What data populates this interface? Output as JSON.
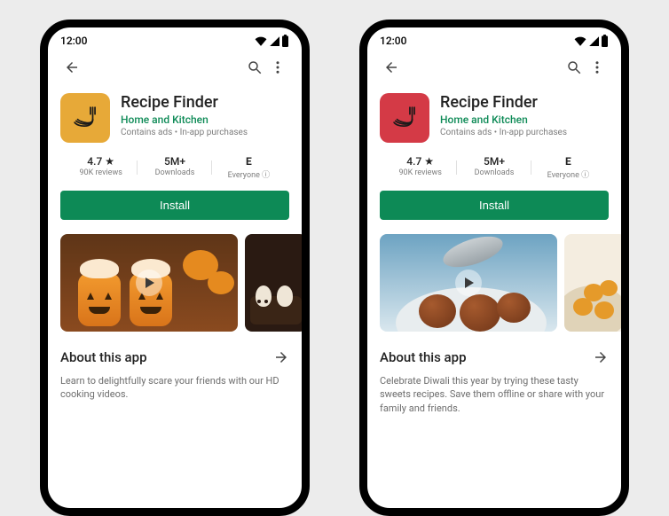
{
  "phones": [
    {
      "status_time": "12:00",
      "app_title": "Recipe Finder",
      "developer": "Home and Kitchen",
      "meta_line": "Contains ads  •  In-app purchases",
      "icon_bg": "#e7a938",
      "rating_line": "4.7 ★",
      "reviews_line": "90K reviews",
      "downloads_value": "5M+",
      "downloads_label": "Downloads",
      "age_value": "E",
      "age_label": "Everyone ⓘ",
      "install_label": "Install",
      "about_heading": "About this app",
      "about_body": "Learn to delightfully scare your friends with our HD cooking videos."
    },
    {
      "status_time": "12:00",
      "app_title": "Recipe Finder",
      "developer": "Home and Kitchen",
      "meta_line": "Contains ads  •  In-app purchases",
      "icon_bg": "#d43a46",
      "rating_line": "4.7 ★",
      "reviews_line": "90K reviews",
      "downloads_value": "5M+",
      "downloads_label": "Downloads",
      "age_value": "E",
      "age_label": "Everyone ⓘ",
      "install_label": "Install",
      "about_heading": "About this app",
      "about_body": "Celebrate Diwali this year by trying these tasty sweets recipes. Save them offline or share with your family and friends."
    }
  ]
}
